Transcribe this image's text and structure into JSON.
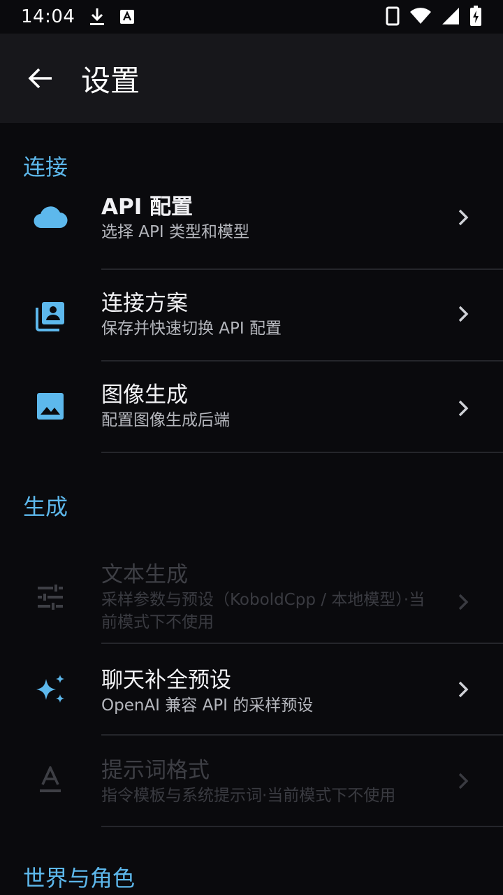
{
  "status_bar": {
    "time": "14:04",
    "left_icons": [
      "download-icon",
      "text-a-icon"
    ],
    "right_icons": [
      "phone-icon",
      "wifi-icon",
      "signal-icon",
      "battery-charging-icon"
    ]
  },
  "app_bar": {
    "title": "设置",
    "back_icon": "arrow-left-icon"
  },
  "sections": {
    "connection": {
      "header": "连接",
      "items": [
        {
          "title": "API 配置",
          "subtitle": "选择 API 类型和模型",
          "icon": "cloud-icon",
          "enabled": true
        },
        {
          "title": "连接方案",
          "subtitle": "保存并快速切换 API 配置",
          "icon": "contact-card-icon",
          "enabled": true
        },
        {
          "title": "图像生成",
          "subtitle": "配置图像生成后端",
          "icon": "image-icon",
          "enabled": true
        }
      ]
    },
    "generation": {
      "header": "生成",
      "items": [
        {
          "title": "文本生成",
          "subtitle": "采样参数与预设（KoboldCpp / 本地模型）·当前模式下不使用",
          "icon": "tune-icon",
          "enabled": false
        },
        {
          "title": "聊天补全预设",
          "subtitle": "OpenAI 兼容 API 的采样预设",
          "icon": "sparkle-icon",
          "enabled": true
        },
        {
          "title": "提示词格式",
          "subtitle": "指令模板与系统提示词·当前模式下不使用",
          "icon": "text-format-icon",
          "enabled": false
        }
      ]
    },
    "world": {
      "header": "世界与角色"
    }
  },
  "colors": {
    "accent": "#5db8ec",
    "background": "#0a0a0d",
    "app_bar": "#17171b",
    "divider": "#25262b",
    "disabled_text": "#3e3f45"
  }
}
